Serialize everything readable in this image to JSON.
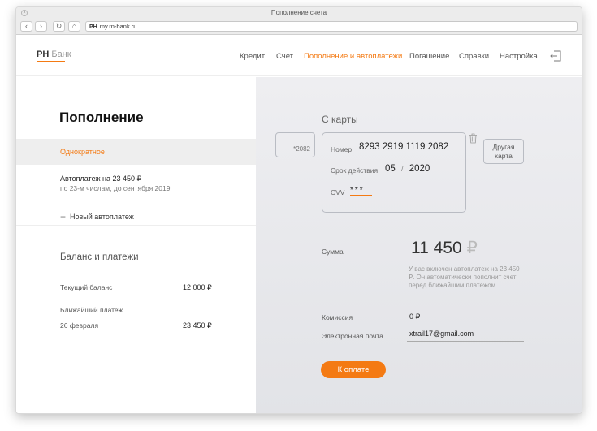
{
  "browser": {
    "window_title": "Пополнение счета",
    "url": "my.rn-bank.ru",
    "favicon_text": "РН",
    "nav_buttons": [
      "chevron-left-icon",
      "chevron-right-icon",
      "reload-icon",
      "home-icon"
    ]
  },
  "header": {
    "logo_primary": "РН",
    "logo_secondary": "Банк",
    "nav": [
      {
        "label": "Кредит",
        "active": false
      },
      {
        "label": "Счет",
        "active": false
      },
      {
        "label": "Пополнение и автоплатежи",
        "active": true
      },
      {
        "label": "Погашение",
        "active": false
      },
      {
        "label": "Справки",
        "active": false
      },
      {
        "label": "Настройка",
        "active": false
      }
    ],
    "logout_icon": "logout-icon"
  },
  "left": {
    "title": "Пополнение",
    "one_time_label": "Однократное",
    "autopay_title": "Автоплатеж на 23 450 ₽",
    "autopay_subtitle": "по 23-м числам, до сентября 2019",
    "new_autopay_label": "Новый автоплатеж",
    "balance_title": "Баланс и платежи",
    "current_balance_label": "Текущий баланс",
    "current_balance_value": "12 000 ₽",
    "next_payment_label": "Ближайший платеж",
    "next_payment_date": "26 февраля",
    "next_payment_value": "23 450 ₽"
  },
  "right": {
    "section_title": "С карты",
    "saved_card": "*2082",
    "card_number_label": "Номер",
    "card_number_value": "8293 2919 1119 2082",
    "expiry_label": "Срок действия",
    "expiry_month": "05",
    "expiry_sep": "/",
    "expiry_year": "2020",
    "cvv_label": "CVV",
    "cvv_value": "***",
    "other_card_line1": "Другая",
    "other_card_line2": "карта",
    "amount_label": "Сумма",
    "amount_value": "11 450",
    "amount_currency": "₽",
    "autopay_note": "У вас включен автоплатеж на 23 450 ₽. Он автоматически пополнит счет перед ближайшим платежом",
    "fee_label": "Комиссия",
    "fee_value": "0 ₽",
    "email_label": "Электронная почта",
    "email_value": "xtrail17@gmail.com",
    "pay_button": "К оплате"
  },
  "colors": {
    "accent": "#f47a13",
    "panel_bg": "#e8e9ec"
  }
}
